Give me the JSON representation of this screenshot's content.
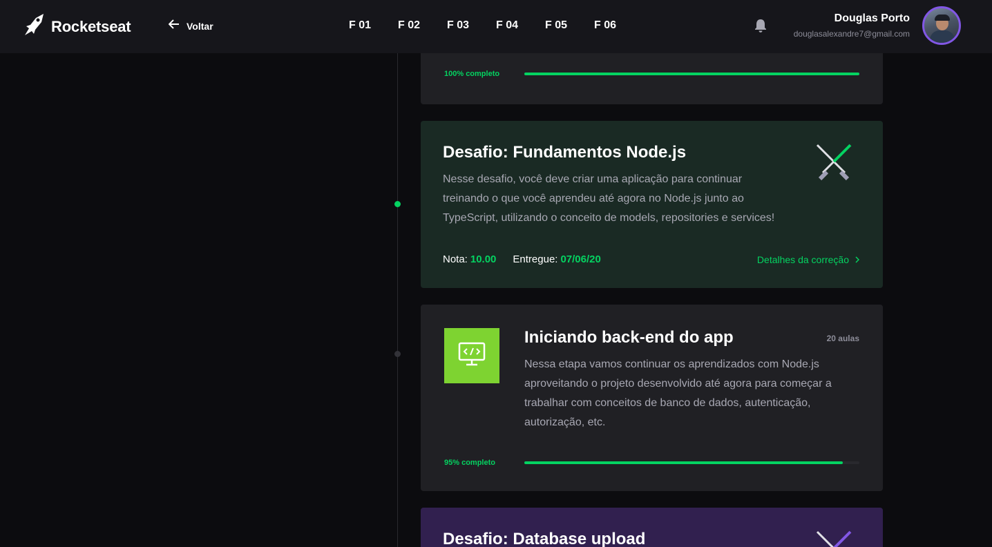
{
  "header": {
    "brand": "Rocketseat",
    "back_label": "Voltar",
    "nav": [
      "F 01",
      "F 02",
      "F 03",
      "F 04",
      "F 05",
      "F 06"
    ],
    "user_name": "Douglas Porto",
    "user_email": "douglasalexandre7@gmail.com",
    "icons": [
      "rocket-logo-icon",
      "arrow-left-icon",
      "bell-icon"
    ]
  },
  "cards": {
    "top": {
      "progress_label": "100% completo",
      "progress": 1.0
    },
    "challenge": {
      "title": "Desafio: Fundamentos Node.js",
      "description": "Nesse desafio, você deve criar uma aplicação para continuar treinando o que você aprendeu até agora no Node.js junto ao TypeScript, utilizando o conceito de models, repositories e services!",
      "grade_label": "Nota:",
      "grade_value": "10.00",
      "delivered_label": "Entregue:",
      "delivered_value": "07/06/20",
      "details_label": "Detalhes da correção",
      "icon": "crossed-lightsabers-icon"
    },
    "module": {
      "title": "Iniciando back-end do app",
      "lessons": "20 aulas",
      "description": "Nessa etapa vamos continuar os aprendizados com Node.js aproveitando o projeto desenvolvido até agora para começar a trabalhar com conceitos de banco de dados, autenticação, autorização, etc.",
      "progress_label": "95% completo",
      "progress": 0.95,
      "icon": "code-monitor-icon"
    },
    "next_challenge": {
      "title": "Desafio: Database upload",
      "icon": "crossed-lightsabers-icon"
    }
  },
  "colors": {
    "accent_green": "#04d361",
    "accent_purple": "#8257e5",
    "module_thumb": "#7ed331"
  }
}
